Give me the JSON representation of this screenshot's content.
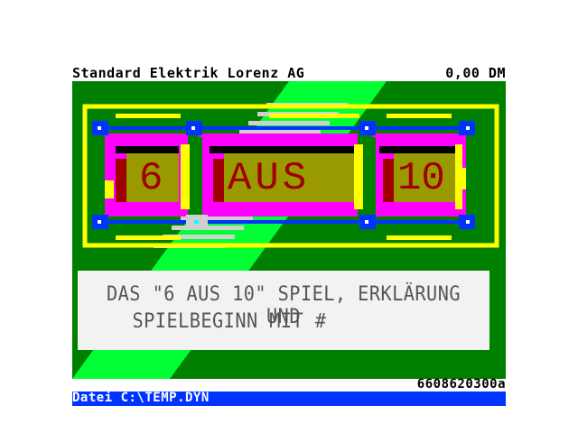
{
  "header": {
    "company": "Standard Elektrik Lorenz AG",
    "balance": "0,00 DM"
  },
  "logo": {
    "blocks": [
      "6",
      "AUS",
      "10"
    ]
  },
  "message": {
    "line1": "DAS \"6 AUS 10\" SPIEL, ERKLÄRUNG UND",
    "line2": "SPIELBEGINN MIT #"
  },
  "footer": {
    "page_id": "6608620300a",
    "file_label": "Datei C:\\TEMP.DYN"
  },
  "colors": {
    "background": "#008000",
    "accent_green": "#00ff33",
    "magenta": "#ff00ff",
    "yellow": "#ffff00",
    "olive": "#999900",
    "dark_red": "#a00000",
    "blue": "#0033ff",
    "status_bar": "#0033ff"
  }
}
